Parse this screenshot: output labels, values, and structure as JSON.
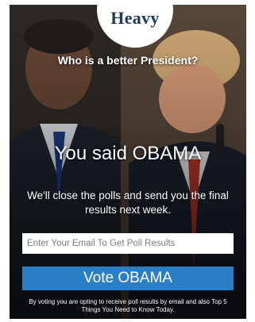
{
  "brand": {
    "logo_text": "Heavy",
    "logo_color": "#1f3a56"
  },
  "poll": {
    "question": "Who is a better President?",
    "result_headline": "You said OBAMA",
    "result_message": "We'll close the polls and send you the final results next week.",
    "email_placeholder": "Enter Your Email To Get Poll Results",
    "vote_button_label": "Vote OBAMA",
    "disclaimer": "By voting you are opting to receive poll results by email and also Top 5 Things You Need to Know Today."
  },
  "colors": {
    "button": "#2a7ec6",
    "text": "#ffffff"
  }
}
